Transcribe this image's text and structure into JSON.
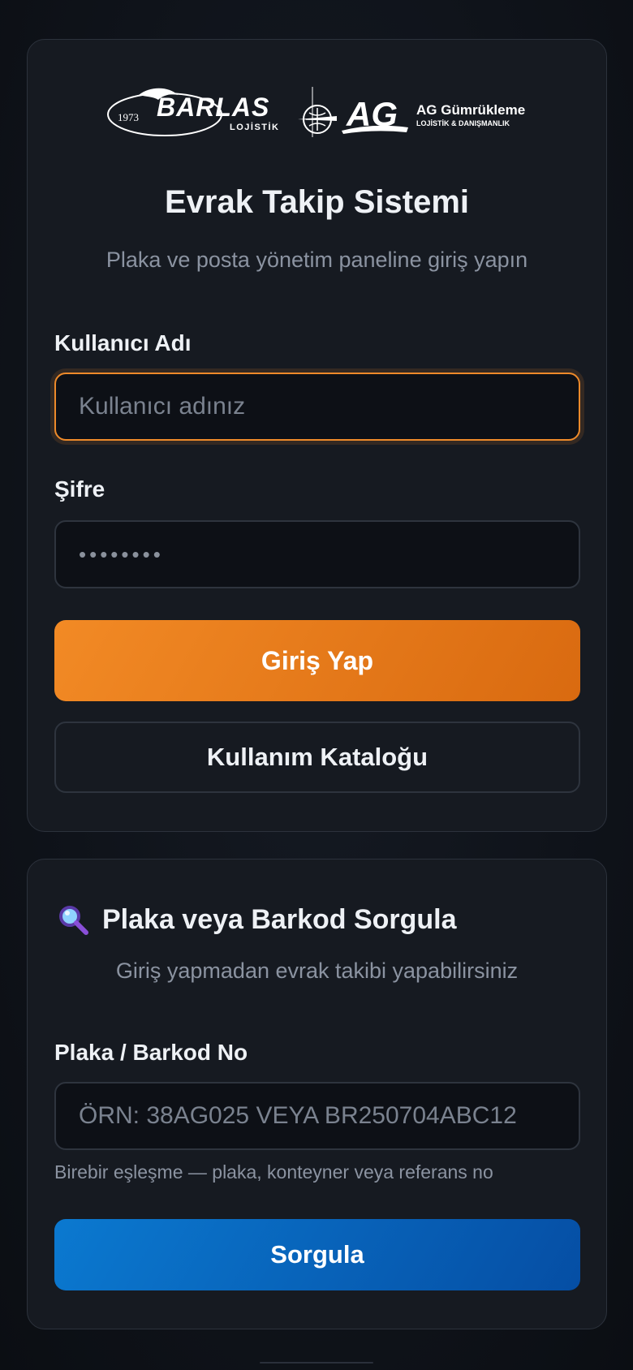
{
  "login": {
    "logo": {
      "year": "1973",
      "barlas_name": "BARLAS",
      "barlas_sub": "LOJİSTİK",
      "ag_mark": "AG",
      "ag_name": "AG Gümrükleme",
      "ag_sub": "LOJİSTİK & DANIŞMANLIK"
    },
    "title": "Evrak Takip Sistemi",
    "subtitle": "Plaka ve posta yönetim paneline giriş yapın",
    "username_label": "Kullanıcı Adı",
    "username_placeholder": "Kullanıcı adınız",
    "password_label": "Şifre",
    "password_value": "••••••••",
    "login_button": "Giriş Yap",
    "catalog_button": "Kullanım Kataloğu"
  },
  "query": {
    "icon": "magnifier-icon",
    "title": "Plaka veya Barkod Sorgula",
    "subtitle": "Giriş yapmadan evrak takibi yapabilirsiniz",
    "field_label": "Plaka / Barkod No",
    "field_placeholder": "ÖRN: 38AG025 VEYA BR250704ABC12",
    "hint": "Birebir eşleşme — plaka, konteyner veya referans no",
    "submit_button": "Sorgula"
  },
  "colors": {
    "accent_orange": "#ee8a2a",
    "accent_blue": "#0b79d0",
    "card_bg": "#161a21",
    "page_bg": "#0f131a"
  }
}
